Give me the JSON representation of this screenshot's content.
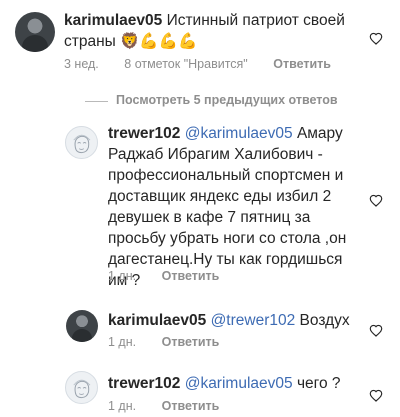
{
  "comments": [
    {
      "username": "karimulaev05",
      "text": "Истинный патриот своей страны 🦁💪💪💪",
      "time": "3 нед.",
      "likes": "8 отметок \"Нравится\"",
      "reply": "Ответить",
      "avatar_icon": "profile-photo-icon"
    },
    {
      "username": "trewer102",
      "mention": "@karimulaev05",
      "text": "Амару Раджаб Ибрагим Халибович - профессиональный спортсмен и доставщик яндекс еды избил 2 девушек в кафе 7 пятниц за просьбу убрать ноги со стола ,он дагестанец.Ну ты как гордишься им ?",
      "time": "1 дн.",
      "reply": "Ответить",
      "avatar_icon": "sketch-face-icon"
    },
    {
      "username": "karimulaev05",
      "mention": "@trewer102",
      "text": "Воздух",
      "time": "1 дн.",
      "reply": "Ответить",
      "avatar_icon": "profile-photo-icon"
    },
    {
      "username": "trewer102",
      "mention": "@karimulaev05",
      "text": "чего ?",
      "time": "1 дн.",
      "reply": "Ответить",
      "avatar_icon": "sketch-face-icon"
    }
  ],
  "view_previous": "Посмотреть 5 предыдущих ответов",
  "like_icon": "heart-outline-icon"
}
